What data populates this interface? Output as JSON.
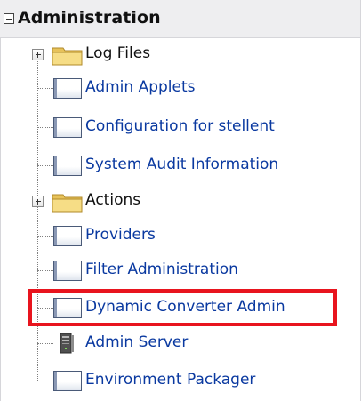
{
  "panel": {
    "title": "Administration",
    "items": [
      {
        "label": "Log Files",
        "kind": "folder",
        "icon": "folder-icon",
        "expandable": true
      },
      {
        "label": "Admin Applets",
        "kind": "link",
        "icon": "page-icon"
      },
      {
        "label": "Configuration for stellent",
        "kind": "link",
        "icon": "page-icon"
      },
      {
        "label": "System Audit Information",
        "kind": "link",
        "icon": "page-icon"
      },
      {
        "label": "Actions",
        "kind": "folder",
        "icon": "folder-icon",
        "expandable": true
      },
      {
        "label": "Providers",
        "kind": "link",
        "icon": "page-icon"
      },
      {
        "label": "Filter Administration",
        "kind": "link",
        "icon": "page-icon"
      },
      {
        "label": "Dynamic Converter Admin",
        "kind": "link",
        "icon": "page-icon",
        "highlighted": true
      },
      {
        "label": "Admin Server",
        "kind": "link",
        "icon": "server-icon"
      },
      {
        "label": "Environment Packager",
        "kind": "link",
        "icon": "page-icon"
      }
    ]
  },
  "colors": {
    "link": "#0a39a0",
    "highlight_border": "#e8141e",
    "header_bg": "#eeeef0"
  }
}
